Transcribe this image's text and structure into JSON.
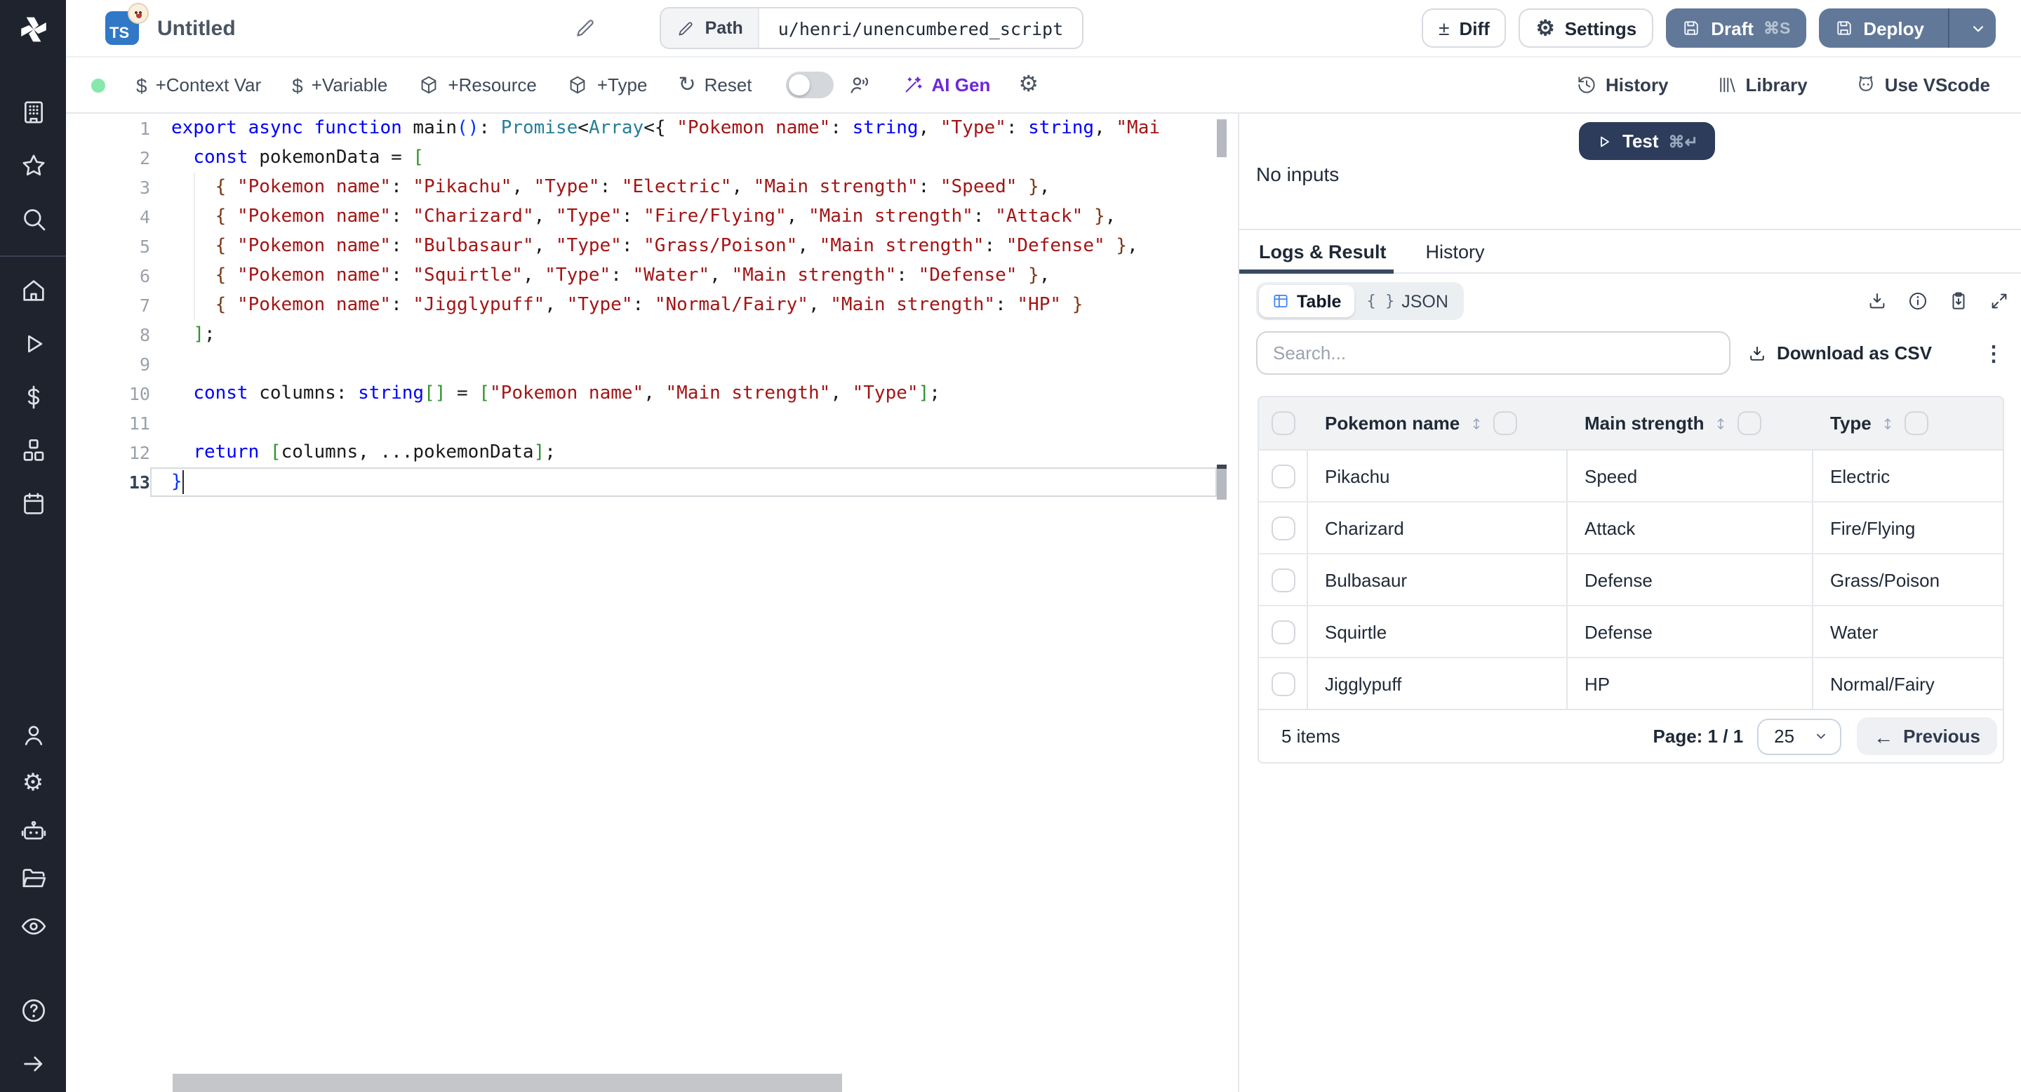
{
  "colors": {
    "sidebar_bg": "#1e232e",
    "ts_badge_blue": "#3178c6",
    "button_slate": "#617899",
    "test_navy": "#2d3c5b",
    "ai_purple": "#6d28d9",
    "status_green": "#86e8ac",
    "table_icon_blue": "#3b82f6"
  },
  "sidebar": {
    "icons_top": [
      "building",
      "star",
      "search"
    ],
    "icons_main": [
      "home",
      "play",
      "dollar",
      "cubes",
      "calendar"
    ],
    "icons_account": [
      "user",
      "gear",
      "robot",
      "folder",
      "eye"
    ],
    "icons_bottom": [
      "help",
      "arrow-right"
    ]
  },
  "header": {
    "language_badge": "TS",
    "title": "Untitled",
    "path_label": "Path",
    "path_value": "u/henri/unencumbered_script",
    "diff_label": "Diff",
    "settings_label": "Settings",
    "settings_icon": "⚙",
    "diff_icon": "±",
    "draft_label": "Draft",
    "draft_shortcut": "⌘S",
    "deploy_label": "Deploy"
  },
  "toolbar": {
    "context_var": "+Context Var",
    "variable": "+Variable",
    "resource": "+Resource",
    "type": "+Type",
    "reset": "Reset",
    "reset_icon": "↻",
    "ai_gen": "AI Gen",
    "gear_icon": "⚙",
    "dollar_icon": "$",
    "history": "History",
    "library": "Library",
    "use_vscode": "Use VScode"
  },
  "editor": {
    "active_line": 13,
    "lines": [
      [
        [
          "k",
          "export"
        ],
        [
          "p",
          " "
        ],
        [
          "k",
          "async"
        ],
        [
          "p",
          " "
        ],
        [
          "k",
          "function"
        ],
        [
          "p",
          " main"
        ],
        [
          "u",
          "()"
        ],
        [
          "p",
          ": "
        ],
        [
          "t",
          "Promise"
        ],
        [
          "p",
          "<"
        ],
        [
          "t",
          "Array"
        ],
        [
          "p",
          "<{ "
        ],
        [
          "s",
          "\"Pokemon name\""
        ],
        [
          "p",
          ": "
        ],
        [
          "k",
          "string"
        ],
        [
          "p",
          ", "
        ],
        [
          "s",
          "\"Type\""
        ],
        [
          "p",
          ": "
        ],
        [
          "k",
          "string"
        ],
        [
          "p",
          ", "
        ],
        [
          "s",
          "\"Mai"
        ]
      ],
      [
        [
          "p",
          "  "
        ],
        [
          "k",
          "const"
        ],
        [
          "p",
          " pokemonData = "
        ],
        [
          "g",
          "["
        ]
      ],
      [
        [
          "p",
          "    "
        ],
        [
          "b",
          "{"
        ],
        [
          "p",
          " "
        ],
        [
          "s",
          "\"Pokemon name\""
        ],
        [
          "p",
          ": "
        ],
        [
          "s",
          "\"Pikachu\""
        ],
        [
          "p",
          ", "
        ],
        [
          "s",
          "\"Type\""
        ],
        [
          "p",
          ": "
        ],
        [
          "s",
          "\"Electric\""
        ],
        [
          "p",
          ", "
        ],
        [
          "s",
          "\"Main strength\""
        ],
        [
          "p",
          ": "
        ],
        [
          "s",
          "\"Speed\""
        ],
        [
          "p",
          " "
        ],
        [
          "b",
          "}"
        ],
        [
          "p",
          ","
        ]
      ],
      [
        [
          "p",
          "    "
        ],
        [
          "b",
          "{"
        ],
        [
          "p",
          " "
        ],
        [
          "s",
          "\"Pokemon name\""
        ],
        [
          "p",
          ": "
        ],
        [
          "s",
          "\"Charizard\""
        ],
        [
          "p",
          ", "
        ],
        [
          "s",
          "\"Type\""
        ],
        [
          "p",
          ": "
        ],
        [
          "s",
          "\"Fire/Flying\""
        ],
        [
          "p",
          ", "
        ],
        [
          "s",
          "\"Main strength\""
        ],
        [
          "p",
          ": "
        ],
        [
          "s",
          "\"Attack\""
        ],
        [
          "p",
          " "
        ],
        [
          "b",
          "}"
        ],
        [
          "p",
          ","
        ]
      ],
      [
        [
          "p",
          "    "
        ],
        [
          "b",
          "{"
        ],
        [
          "p",
          " "
        ],
        [
          "s",
          "\"Pokemon name\""
        ],
        [
          "p",
          ": "
        ],
        [
          "s",
          "\"Bulbasaur\""
        ],
        [
          "p",
          ", "
        ],
        [
          "s",
          "\"Type\""
        ],
        [
          "p",
          ": "
        ],
        [
          "s",
          "\"Grass/Poison\""
        ],
        [
          "p",
          ", "
        ],
        [
          "s",
          "\"Main strength\""
        ],
        [
          "p",
          ": "
        ],
        [
          "s",
          "\"Defense\""
        ],
        [
          "p",
          " "
        ],
        [
          "b",
          "}"
        ],
        [
          "p",
          ","
        ]
      ],
      [
        [
          "p",
          "    "
        ],
        [
          "b",
          "{"
        ],
        [
          "p",
          " "
        ],
        [
          "s",
          "\"Pokemon name\""
        ],
        [
          "p",
          ": "
        ],
        [
          "s",
          "\"Squirtle\""
        ],
        [
          "p",
          ", "
        ],
        [
          "s",
          "\"Type\""
        ],
        [
          "p",
          ": "
        ],
        [
          "s",
          "\"Water\""
        ],
        [
          "p",
          ", "
        ],
        [
          "s",
          "\"Main strength\""
        ],
        [
          "p",
          ": "
        ],
        [
          "s",
          "\"Defense\""
        ],
        [
          "p",
          " "
        ],
        [
          "b",
          "}"
        ],
        [
          "p",
          ","
        ]
      ],
      [
        [
          "p",
          "    "
        ],
        [
          "b",
          "{"
        ],
        [
          "p",
          " "
        ],
        [
          "s",
          "\"Pokemon name\""
        ],
        [
          "p",
          ": "
        ],
        [
          "s",
          "\"Jigglypuff\""
        ],
        [
          "p",
          ", "
        ],
        [
          "s",
          "\"Type\""
        ],
        [
          "p",
          ": "
        ],
        [
          "s",
          "\"Normal/Fairy\""
        ],
        [
          "p",
          ", "
        ],
        [
          "s",
          "\"Main strength\""
        ],
        [
          "p",
          ": "
        ],
        [
          "s",
          "\"HP\""
        ],
        [
          "p",
          " "
        ],
        [
          "b",
          "}"
        ]
      ],
      [
        [
          "p",
          "  "
        ],
        [
          "g",
          "]"
        ],
        [
          "p",
          ";"
        ]
      ],
      [],
      [
        [
          "p",
          "  "
        ],
        [
          "k",
          "const"
        ],
        [
          "p",
          " columns: "
        ],
        [
          "k",
          "string"
        ],
        [
          "g",
          "[]"
        ],
        [
          "p",
          " = "
        ],
        [
          "g",
          "["
        ],
        [
          "s",
          "\"Pokemon name\""
        ],
        [
          "p",
          ", "
        ],
        [
          "s",
          "\"Main strength\""
        ],
        [
          "p",
          ", "
        ],
        [
          "s",
          "\"Type\""
        ],
        [
          "g",
          "]"
        ],
        [
          "p",
          ";"
        ]
      ],
      [],
      [
        [
          "p",
          "  "
        ],
        [
          "k",
          "return"
        ],
        [
          "p",
          " "
        ],
        [
          "g",
          "["
        ],
        [
          "p",
          "columns, ...pokemonData"
        ],
        [
          "g",
          "]"
        ],
        [
          "p",
          ";"
        ]
      ],
      [
        [
          "u",
          "}"
        ]
      ]
    ]
  },
  "run_panel": {
    "test_label": "Test",
    "test_shortcut": "⌘↵",
    "no_inputs": "No inputs",
    "tabs": [
      "Logs & Result",
      "History"
    ],
    "view_table": "Table",
    "view_json": "JSON",
    "json_braces": "{ }",
    "icons": [
      "download-icon",
      "info-icon",
      "copy-result-icon",
      "expand-icon"
    ],
    "search_placeholder": "Search...",
    "download_csv": "Download as CSV",
    "kebab_icon": "⋮"
  },
  "table": {
    "columns": [
      "Pokemon name",
      "Main strength",
      "Type"
    ],
    "rows": [
      [
        "Pikachu",
        "Speed",
        "Electric"
      ],
      [
        "Charizard",
        "Attack",
        "Fire/Flying"
      ],
      [
        "Bulbasaur",
        "Defense",
        "Grass/Poison"
      ],
      [
        "Squirtle",
        "Defense",
        "Water"
      ],
      [
        "Jigglypuff",
        "HP",
        "Normal/Fairy"
      ]
    ],
    "footer": {
      "items_count": "5 items",
      "page_label": "Page: 1 / 1",
      "page_size": "25",
      "previous": "Previous",
      "previous_arrow": "←"
    }
  }
}
